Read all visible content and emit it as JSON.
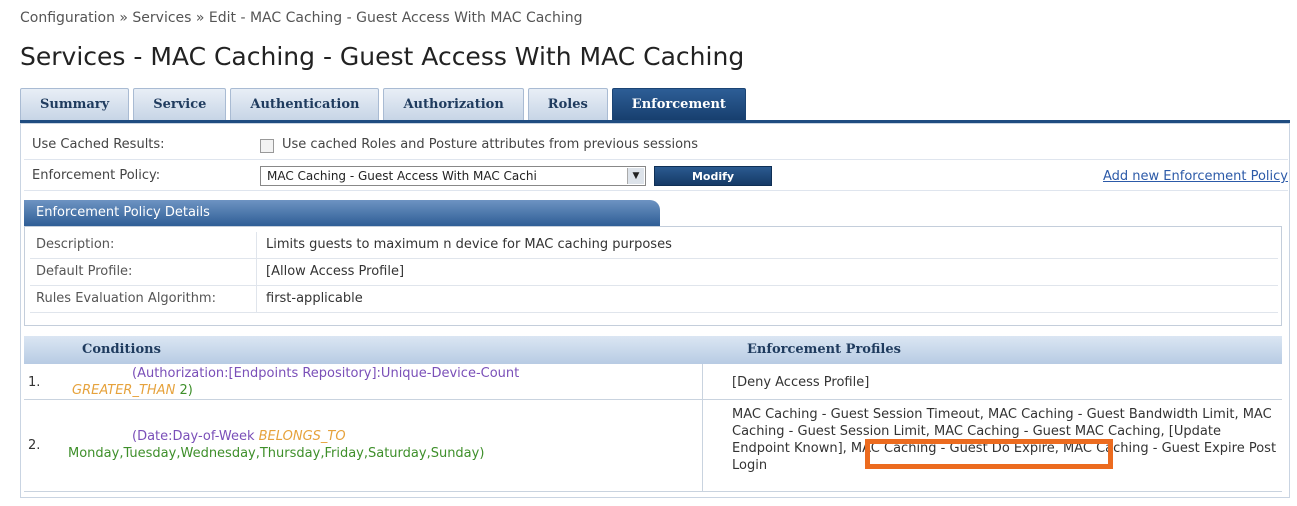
{
  "breadcrumb": "Configuration » Services » Edit - MAC Caching - Guest Access With MAC Caching",
  "title": "Services - MAC Caching - Guest Access With MAC Caching",
  "tabs": [
    "Summary",
    "Service",
    "Authentication",
    "Authorization",
    "Roles",
    "Enforcement"
  ],
  "active_tab": "Enforcement",
  "form": {
    "cached_label": "Use Cached Results:",
    "cached_checkbox_text": "Use cached Roles and Posture attributes from previous sessions",
    "policy_label": "Enforcement Policy:",
    "policy_value": "MAC Caching - Guest Access With MAC Cachi",
    "modify_label": "Modify",
    "add_link": "Add new Enforcement Policy"
  },
  "details": {
    "header": "Enforcement Policy Details",
    "description_label": "Description:",
    "description_value": "Limits guests to maximum n device for MAC caching purposes",
    "default_profile_label": "Default Profile:",
    "default_profile_value": "[Allow Access Profile]",
    "algorithm_label": "Rules Evaluation Algorithm:",
    "algorithm_value": "first-applicable"
  },
  "rules": {
    "conditions_header": "Conditions",
    "profiles_header": "Enforcement Profiles",
    "rows": [
      {
        "num": "1.",
        "cond_attr": "(Authorization:[Endpoints Repository]:Unique-Device-Count",
        "cond_op": "GREATER_THAN",
        "cond_val": "2)",
        "profiles": "[Deny Access Profile]"
      },
      {
        "num": "2.",
        "cond_attr": "(Date:Day-of-Week",
        "cond_op": "BELONGS_TO",
        "cond_val": "Monday,Tuesday,Wednesday,Thursday,Friday,Saturday,Sunday)",
        "profiles": "MAC Caching - Guest Session Timeout, MAC Caching - Guest Bandwidth Limit, MAC Caching - Guest Session Limit, MAC Caching - Guest MAC Caching, [Update Endpoint Known], MAC Caching - Guest Do Expire, MAC Caching - Guest Expire Post Login"
      }
    ]
  },
  "colors": {
    "accent": "#1f4c80",
    "highlight": "#ec6b1f"
  }
}
